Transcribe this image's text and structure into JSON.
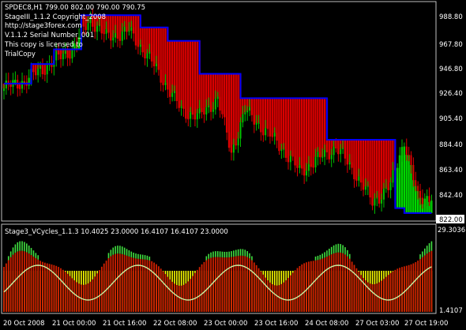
{
  "colors": {
    "background": "#000000",
    "frame": "#c0c0c0",
    "bull_candle": "#00c000",
    "bear_candle": "#e00000",
    "stop_line": "#0000ff",
    "band_green": "#00ff00",
    "band_red": "#ff0000",
    "osc_red": "#d02000",
    "osc_yellow": "#ffff00",
    "osc_green": "#40e040",
    "osc_line": "#c8f0a0",
    "text": "#ffffff"
  },
  "main_panel": {
    "header": "SPDEC8,H1  799.00 802.00 790.00 790.75",
    "info_lines": [
      "StageIII_1.1.2  Copyright_2008",
      "http://stage3forex.com",
      "V.1.1.2  Serial Number_001",
      "This copy is licensed to",
      "TrialCopy"
    ],
    "price_labels": [
      "988.80",
      "967.80",
      "946.80",
      "926.40",
      "905.40",
      "884.40",
      "863.40",
      "842.40",
      "822.00"
    ],
    "price_min": 822.0,
    "price_max": 988.8,
    "current_price_tag": "822.00"
  },
  "indicator_panel": {
    "header": "Stage3_VCycles_1.1.3  10.4025  23.0000  16.4107  16.4107  23.0000",
    "scale_top": "29.3036",
    "scale_bottom": "1.4107"
  },
  "time_axis": {
    "labels": [
      "20 Oct 2008",
      "21 Oct 00:00",
      "21 Oct 16:00",
      "22 Oct 08:00",
      "23 Oct 00:00",
      "23 Oct 16:00",
      "24 Oct 08:00",
      "27 Oct 03:00",
      "27 Oct 19:00"
    ]
  },
  "chart_data": {
    "type": "candlestick",
    "symbol": "SPDEC8",
    "timeframe": "H1",
    "ohlc_last": {
      "open": 799.0,
      "high": 802.0,
      "low": 790.0,
      "close": 790.75
    },
    "approx_close_path": [
      {
        "bar": 0,
        "close": 928
      },
      {
        "bar": 10,
        "close": 935
      },
      {
        "bar": 20,
        "close": 948
      },
      {
        "bar": 30,
        "close": 960
      },
      {
        "bar": 38,
        "close": 985
      },
      {
        "bar": 45,
        "close": 970
      },
      {
        "bar": 55,
        "close": 975
      },
      {
        "bar": 62,
        "close": 958
      },
      {
        "bar": 70,
        "close": 935
      },
      {
        "bar": 78,
        "close": 910
      },
      {
        "bar": 86,
        "close": 905
      },
      {
        "bar": 94,
        "close": 920
      },
      {
        "bar": 100,
        "close": 875
      },
      {
        "bar": 106,
        "close": 910
      },
      {
        "bar": 114,
        "close": 895
      },
      {
        "bar": 122,
        "close": 880
      },
      {
        "bar": 130,
        "close": 860
      },
      {
        "bar": 138,
        "close": 870
      },
      {
        "bar": 146,
        "close": 880
      },
      {
        "bar": 154,
        "close": 860
      },
      {
        "bar": 162,
        "close": 835
      },
      {
        "bar": 170,
        "close": 848
      },
      {
        "bar": 176,
        "close": 886
      },
      {
        "bar": 182,
        "close": 838
      },
      {
        "bar": 188,
        "close": 840
      }
    ],
    "stop_line_steps": [
      {
        "from_bar": 0,
        "to_bar": 12,
        "value": 932
      },
      {
        "from_bar": 12,
        "to_bar": 22,
        "value": 948
      },
      {
        "from_bar": 22,
        "to_bar": 34,
        "value": 960
      },
      {
        "from_bar": 34,
        "to_bar": 60,
        "value": 988
      },
      {
        "from_bar": 60,
        "to_bar": 72,
        "value": 978
      },
      {
        "from_bar": 72,
        "to_bar": 86,
        "value": 967
      },
      {
        "from_bar": 86,
        "to_bar": 104,
        "value": 940
      },
      {
        "from_bar": 104,
        "to_bar": 110,
        "value": 920
      },
      {
        "from_bar": 110,
        "to_bar": 142,
        "value": 920
      },
      {
        "from_bar": 142,
        "to_bar": 160,
        "value": 886
      },
      {
        "from_bar": 160,
        "to_bar": 172,
        "value": 886
      },
      {
        "from_bar": 172,
        "to_bar": 176,
        "value": 830
      },
      {
        "from_bar": 176,
        "to_bar": 188,
        "value": 826
      }
    ]
  }
}
